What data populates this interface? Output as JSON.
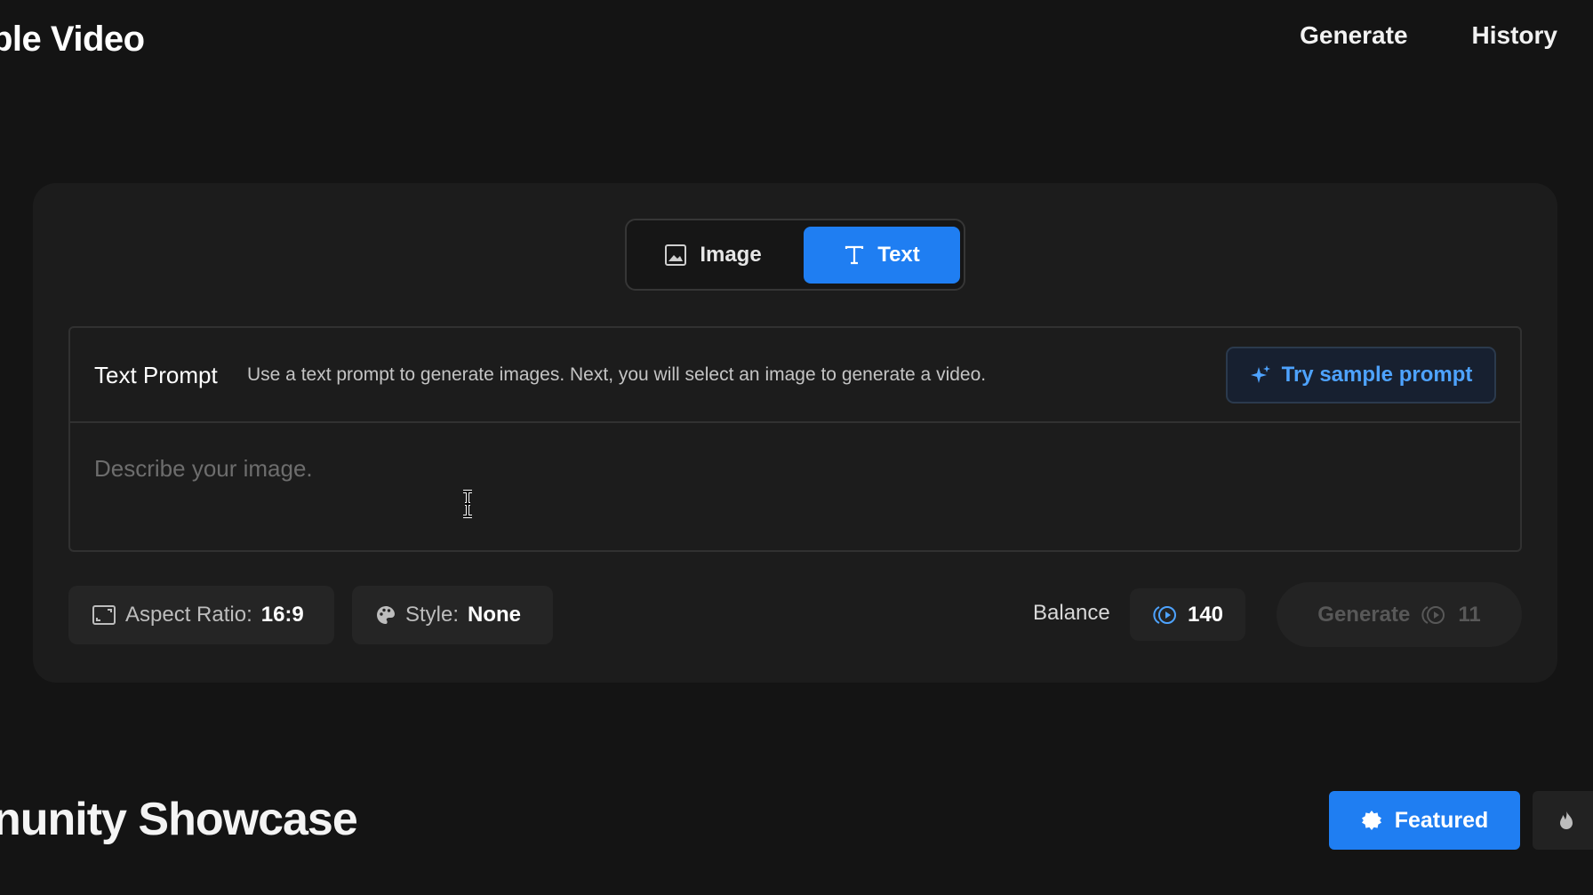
{
  "header": {
    "title": "ble Video",
    "nav": [
      {
        "label": "Generate"
      },
      {
        "label": "History"
      }
    ]
  },
  "mode_toggle": {
    "image_label": "Image",
    "text_label": "Text",
    "selected": "Text"
  },
  "prompt": {
    "label": "Text Prompt",
    "description": "Use a text prompt to generate images. Next, you will select an image to generate a video.",
    "sample_button": "Try sample prompt",
    "placeholder": "Describe your image.",
    "value": ""
  },
  "options": {
    "aspect_label": "Aspect Ratio:",
    "aspect_value": "16:9",
    "style_label": "Style:",
    "style_value": "None"
  },
  "balance": {
    "label": "Balance",
    "value": "140"
  },
  "generate": {
    "label": "Generate",
    "cost": "11",
    "enabled": false
  },
  "showcase": {
    "title": "nunity Showcase",
    "featured_label": "Featured"
  },
  "colors": {
    "accent": "#1f7ef2",
    "link": "#4ea3ff",
    "background": "#141414",
    "card": "#1c1c1c"
  },
  "icons": [
    "image-icon",
    "text-icon",
    "sparkle-icon",
    "aspect-ratio-icon",
    "palette-icon",
    "credit-icon",
    "star-badge-icon",
    "flame-icon",
    "text-cursor-icon"
  ]
}
